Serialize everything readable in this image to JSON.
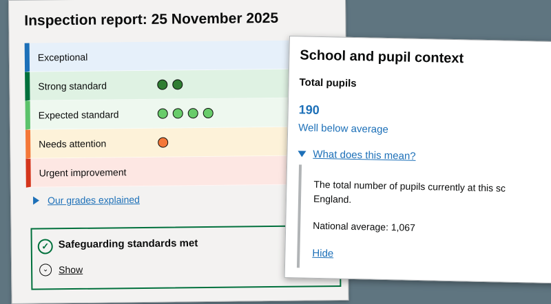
{
  "report": {
    "title": "Inspection report: 25 November 2025",
    "grades": [
      {
        "label": "Exceptional",
        "dots": 0,
        "border_color": "#1d70b8",
        "bg_color": "#e6f0fa",
        "dot_color": ""
      },
      {
        "label": "Strong standard",
        "dots": 2,
        "border_color": "#00703c",
        "bg_color": "#dff2e3",
        "dot_color": "#2f7d32"
      },
      {
        "label": "Expected standard",
        "dots": 4,
        "border_color": "#5cc26b",
        "bg_color": "#eef8ef",
        "dot_color": "#68cc6a"
      },
      {
        "label": "Needs attention",
        "dots": 1,
        "border_color": "#f47738",
        "bg_color": "#fdf2d9",
        "dot_color": "#f47738"
      },
      {
        "label": "Urgent improvement",
        "dots": 0,
        "border_color": "#d4351c",
        "bg_color": "#fde7e3",
        "dot_color": ""
      }
    ],
    "grades_link": "Our grades explained",
    "safeguarding": {
      "title": "Safeguarding standards met",
      "show_label": "Show",
      "status_color": "#00703c"
    }
  },
  "context": {
    "title": "School and pupil context",
    "metric_label": "Total pupils",
    "metric_value": "190",
    "metric_desc": "Well below average",
    "details_summary": "What does this mean?",
    "details_text": "The total number of pupils currently at this sc\nEngland.",
    "national_average": "National average: 1,067",
    "hide_label": "Hide"
  }
}
